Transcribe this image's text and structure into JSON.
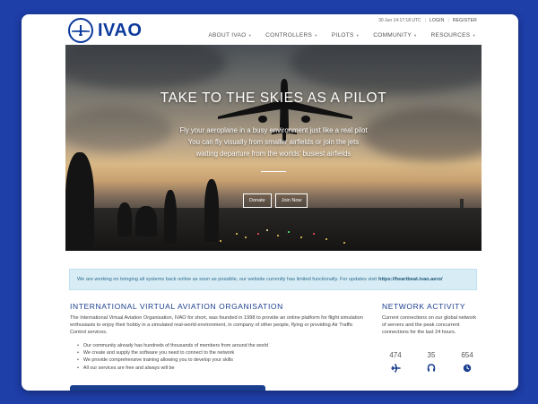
{
  "brand": {
    "name": "IVAO",
    "color": "#0d3a9b",
    "background": "#1e3ea8"
  },
  "topbar": {
    "datetime": "30 Jun 14:17:18 UTC",
    "login": "LOGIN",
    "register": "REGISTER"
  },
  "nav": {
    "items": [
      {
        "label": "ABOUT IVAO"
      },
      {
        "label": "CONTROLLERS"
      },
      {
        "label": "PILOTS"
      },
      {
        "label": "COMMUNITY"
      },
      {
        "label": "RESOURCES"
      }
    ]
  },
  "hero": {
    "title": "TAKE TO THE SKIES AS A PILOT",
    "line1": "Fly your aeroplane in a busy environment just like a real pilot",
    "line2": "You can fly visually from smaller airfields or join the jets",
    "line3": "waiting departure from the worlds' busiest airfields",
    "donate": "Donate",
    "join": "Join Now"
  },
  "notice": {
    "text": "We are working on bringing all systems back online as soon as possible, our website currently has limited functionally. For updates visit",
    "link": "https://heartbeat.ivao.aero/"
  },
  "about": {
    "title": "INTERNATIONAL VIRTUAL AVIATION ORGANISATION",
    "body": "The International Virtual Aviation Organisation, IVAO for short, was founded in 1998 to provide an online platform for flight simulation enthusiasts to enjoy their hobby in a simulated real-world environment, in company of other people, flying or providing Air Traffic Control services.",
    "bullets": [
      "Our community already has hundreds of thousands of members from around the world",
      "We create and supply the software you need to connect to the network",
      "We provide comprehensive training allowing you to develop your skills",
      "All our services are free and always will be"
    ]
  },
  "network": {
    "title": "NETWORK ACTIVITY",
    "body": "Current connections on our global network of servers and the peak concurrent connections for the last 24 hours.",
    "stats": [
      {
        "value": "474",
        "icon": "plane-icon"
      },
      {
        "value": "35",
        "icon": "headset-icon"
      },
      {
        "value": "654",
        "icon": "clock-icon"
      }
    ]
  }
}
